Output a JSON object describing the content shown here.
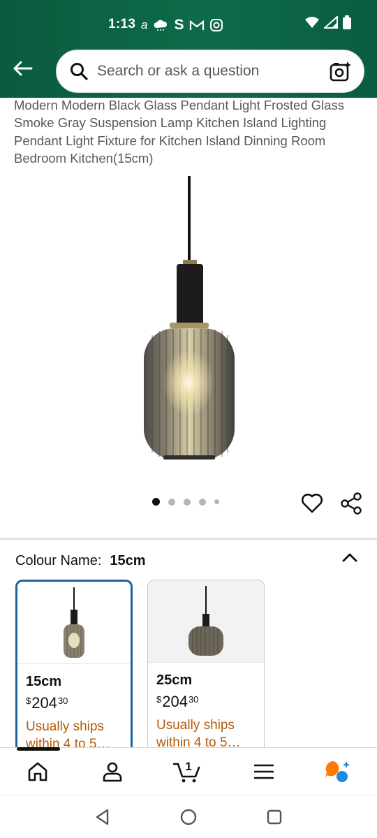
{
  "status_bar": {
    "time": "1:13",
    "left_icons": [
      "amazon-smile-icon",
      "cloud-icon",
      "s-app-icon",
      "gmail-icon",
      "instagram-icon"
    ],
    "right_icons": [
      "wifi-icon",
      "signal-icon",
      "battery-icon"
    ]
  },
  "header": {
    "search_placeholder": "Search or ask a question"
  },
  "product": {
    "title": "Modern Modern Black Glass Pendant Light Frosted Glass Smoke Gray Suspension Lamp Kitchen Island Lighting Pendant Light Fixture for Kitchen Island Dinning Room Bedroom Kitchen(15cm)",
    "image_count": 5,
    "active_image_index": 0
  },
  "variants": {
    "label": "Colour Name:",
    "selected": "15cm",
    "options": [
      {
        "size": "15cm",
        "currency": "$",
        "price_whole": "204",
        "price_cents": "30",
        "shipping": "Usually ships within 4 to 5…",
        "selected": true
      },
      {
        "size": "25cm",
        "currency": "$",
        "price_whole": "204",
        "price_cents": "30",
        "shipping": "Usually ships within 4 to 5…",
        "selected": false
      }
    ]
  },
  "bottom_nav": {
    "items": [
      "home-icon",
      "account-icon",
      "cart-icon",
      "menu-icon",
      "rufus-assistant-icon"
    ],
    "cart_count": "1"
  },
  "colors": {
    "header_green": "#0e6b49",
    "selected_border": "#2162a1",
    "shipping_orange": "#b4590a"
  }
}
